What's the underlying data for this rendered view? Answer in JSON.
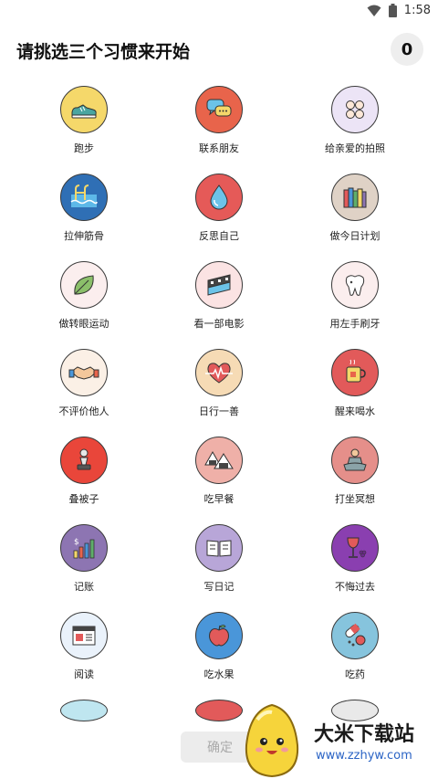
{
  "status_bar": {
    "time": "1:58"
  },
  "header": {
    "title": "请挑选三个习惯来开始",
    "selected_count": "0"
  },
  "habits": [
    {
      "label": "跑步",
      "icon": "sneaker-icon",
      "bg": "#f5d86a"
    },
    {
      "label": "联系朋友",
      "icon": "chat-bubbles-icon",
      "bg": "#e8644b"
    },
    {
      "label": "给亲爱的拍照",
      "icon": "camera-faces-icon",
      "bg": "#ece4f6"
    },
    {
      "label": "拉伸筋骨",
      "icon": "pool-icon",
      "bg": "#2f6fb5"
    },
    {
      "label": "反思自己",
      "icon": "water-drop-icon",
      "bg": "#e55a58"
    },
    {
      "label": "做今日计划",
      "icon": "books-icon",
      "bg": "#dfd2c6"
    },
    {
      "label": "做转眼运动",
      "icon": "leaf-icon",
      "bg": "#fbeeee"
    },
    {
      "label": "看一部电影",
      "icon": "film-icon",
      "bg": "#fbe3e3"
    },
    {
      "label": "用左手刷牙",
      "icon": "tooth-icon",
      "bg": "#fbeeee"
    },
    {
      "label": "不评价他人",
      "icon": "handshake-icon",
      "bg": "#fbf0e6"
    },
    {
      "label": "日行一善",
      "icon": "heartbeat-icon",
      "bg": "#f6dbb5"
    },
    {
      "label": "醒来喝水",
      "icon": "mug-icon",
      "bg": "#e25a5a"
    },
    {
      "label": "叠被子",
      "icon": "chess-pawn-icon",
      "bg": "#e9463a"
    },
    {
      "label": "吃早餐",
      "icon": "rice-ball-icon",
      "bg": "#efb0a8"
    },
    {
      "label": "打坐冥想",
      "icon": "meditation-icon",
      "bg": "#e58f8a"
    },
    {
      "label": "记账",
      "icon": "chart-growth-icon",
      "bg": "#8d75b2"
    },
    {
      "label": "写日记",
      "icon": "open-book-icon",
      "bg": "#b8a6d8"
    },
    {
      "label": "不悔过去",
      "icon": "wine-glass-icon",
      "bg": "#8a3fb0"
    },
    {
      "label": "阅读",
      "icon": "newspaper-icon",
      "bg": "#eaf2fb"
    },
    {
      "label": "吃水果",
      "icon": "apple-icon",
      "bg": "#4a96d9"
    },
    {
      "label": "吃药",
      "icon": "pills-icon",
      "bg": "#86c4dd"
    }
  ],
  "partial_row": [
    {
      "icon": "partial-icon-1",
      "bg": "#bfe6f0"
    },
    {
      "icon": "partial-icon-2",
      "bg": "#e25a5a"
    },
    {
      "icon": "partial-icon-3",
      "bg": "#e9e9e9"
    }
  ],
  "confirm_button": {
    "label": "确定"
  },
  "watermark": {
    "title": "大米下载站",
    "url": "www.zzhyw.com"
  }
}
